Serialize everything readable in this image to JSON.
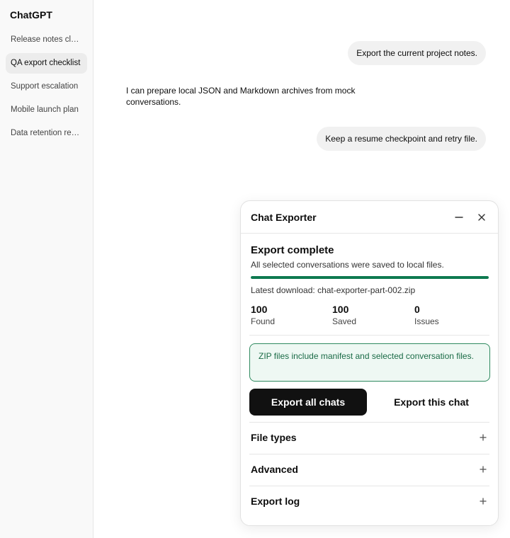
{
  "app": {
    "title": "ChatGPT"
  },
  "sidebar": {
    "items": [
      {
        "label": "Release notes cleanup",
        "active": false
      },
      {
        "label": "QA export checklist",
        "active": true
      },
      {
        "label": "Support escalation",
        "active": false
      },
      {
        "label": "Mobile launch plan",
        "active": false
      },
      {
        "label": "Data retention review",
        "active": false
      }
    ]
  },
  "messages": {
    "user_1": "Export the current project notes.",
    "assistant_1": "I can prepare local JSON and Markdown archives from mock conversations.",
    "user_2": "Keep a resume checkpoint and retry file."
  },
  "exporter": {
    "title": "Chat Exporter",
    "minimize_icon": "minus-icon",
    "close_icon": "close-icon",
    "status_title": "Export complete",
    "status_sub": "All selected conversations were saved to local files.",
    "progress": 1.0,
    "progress_color": "#0e7a50",
    "latest_download": "Latest download: chat-exporter-part-002.zip",
    "stats": {
      "found": {
        "value": "100",
        "label": "Found"
      },
      "saved": {
        "value": "100",
        "label": "Saved"
      },
      "issues": {
        "value": "0",
        "label": "Issues"
      }
    },
    "note": "ZIP files include manifest and selected conversation files.",
    "export_all_label": "Export all chats",
    "export_this_label": "Export this chat",
    "sections": [
      {
        "label": "File types",
        "icon": "plus-icon"
      },
      {
        "label": "Advanced",
        "icon": "plus-icon"
      },
      {
        "label": "Export log",
        "icon": "plus-icon"
      }
    ]
  }
}
